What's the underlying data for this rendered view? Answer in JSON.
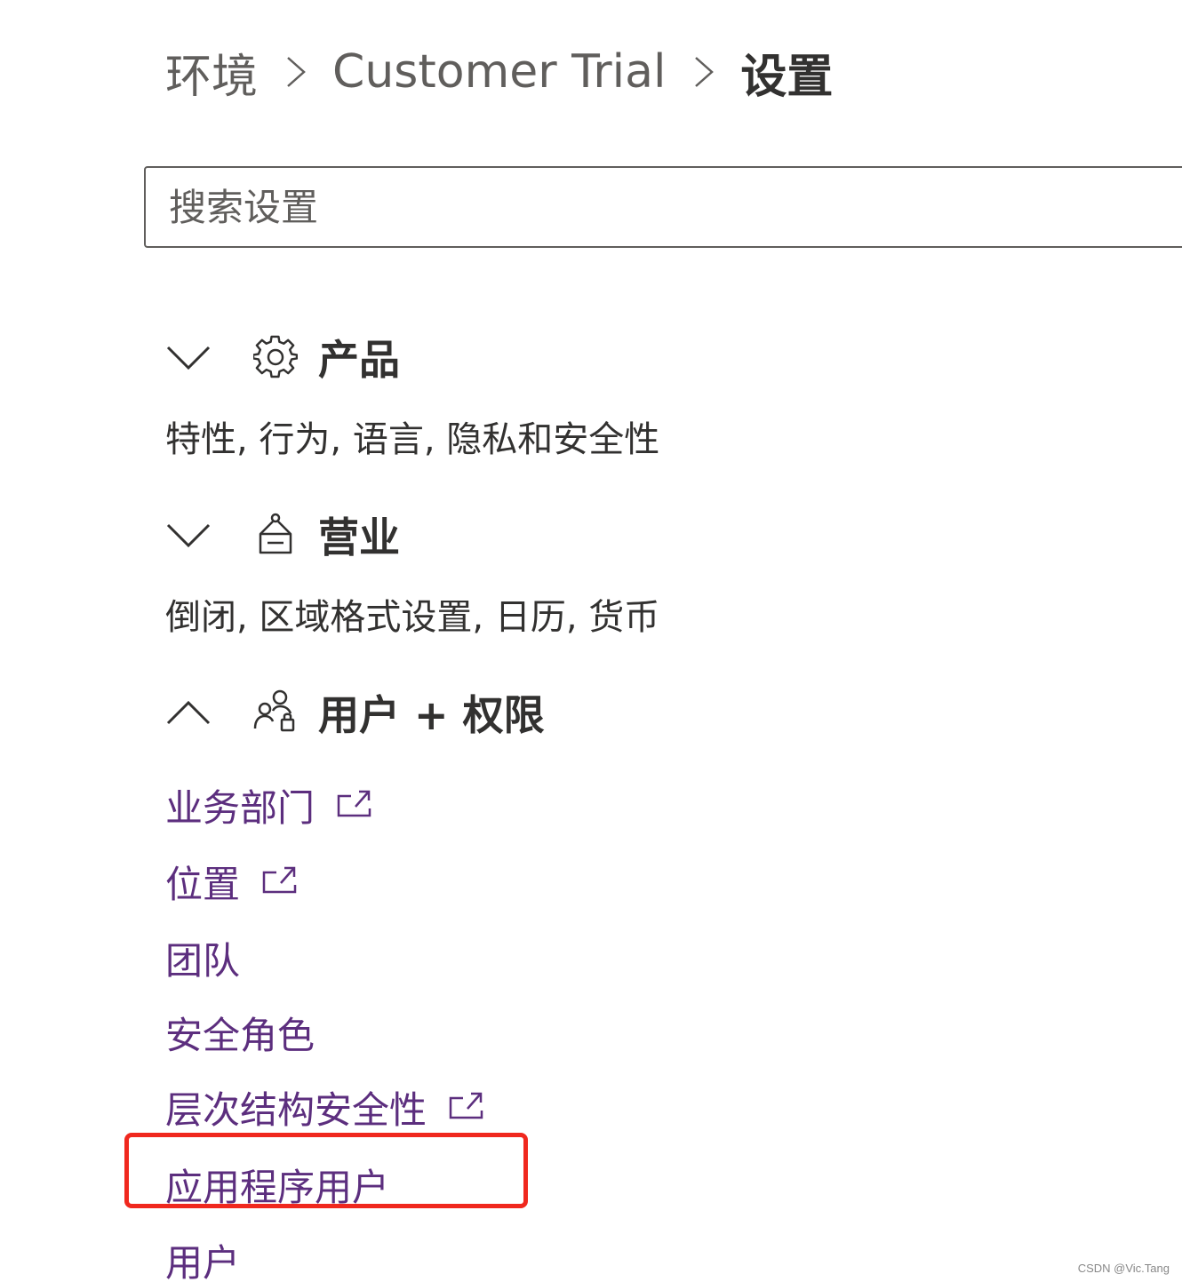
{
  "breadcrumb": {
    "items": [
      "环境",
      "Customer Trial"
    ],
    "current": "设置"
  },
  "search": {
    "placeholder": "搜索设置"
  },
  "sections": [
    {
      "title": "产品",
      "icon": "gear-icon",
      "expanded": false,
      "description": "特性, 行为, 语言, 隐私和安全性"
    },
    {
      "title": "营业",
      "icon": "store-sign-icon",
      "expanded": false,
      "description": "倒闭, 区域格式设置, 日历, 货币"
    },
    {
      "title": "用户 + 权限",
      "icon": "people-lock-icon",
      "expanded": true,
      "links": [
        {
          "label": "业务部门",
          "external": true
        },
        {
          "label": "位置",
          "external": true
        },
        {
          "label": "团队",
          "external": false
        },
        {
          "label": "安全角色",
          "external": false
        },
        {
          "label": "层次结构安全性",
          "external": true
        },
        {
          "label": "应用程序用户",
          "external": false,
          "highlighted": true
        },
        {
          "label": "用户",
          "external": false
        }
      ]
    }
  ],
  "colors": {
    "link": "#5c2e7e",
    "text": "#323130",
    "secondary_text": "#605e5c",
    "highlight_border": "#f0281e"
  },
  "watermark": "CSDN @Vic.Tang"
}
